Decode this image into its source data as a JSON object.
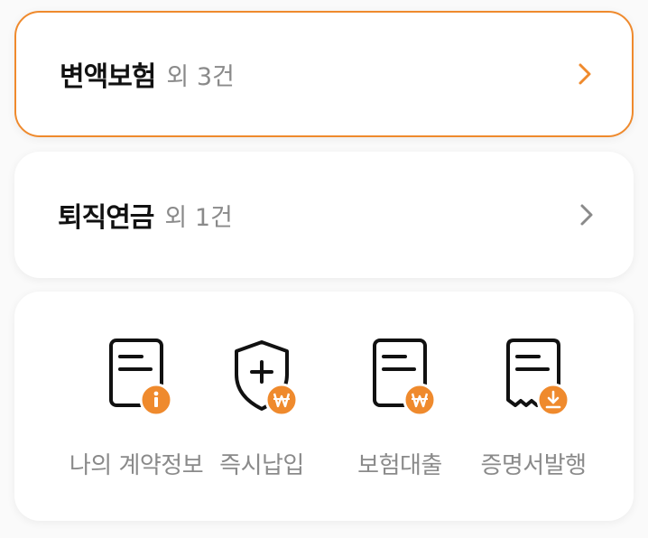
{
  "accent_color": "#ef8a2d",
  "contracts": [
    {
      "title": "변액보험",
      "count": "외 3건",
      "chevron_color": "#ef8a2d",
      "icon": "chevron-right-icon"
    },
    {
      "title": "퇴직연금",
      "count": "외 1건",
      "chevron_color": "#8a8a8a",
      "icon": "chevron-right-icon"
    }
  ],
  "quick_menu": [
    {
      "label": "나의 계약정보",
      "icon": "document-info-icon"
    },
    {
      "label": "즉시납입",
      "icon": "shield-won-icon"
    },
    {
      "label": "보험대출",
      "icon": "document-won-icon"
    },
    {
      "label": "증명서발행",
      "icon": "receipt-download-icon"
    }
  ]
}
